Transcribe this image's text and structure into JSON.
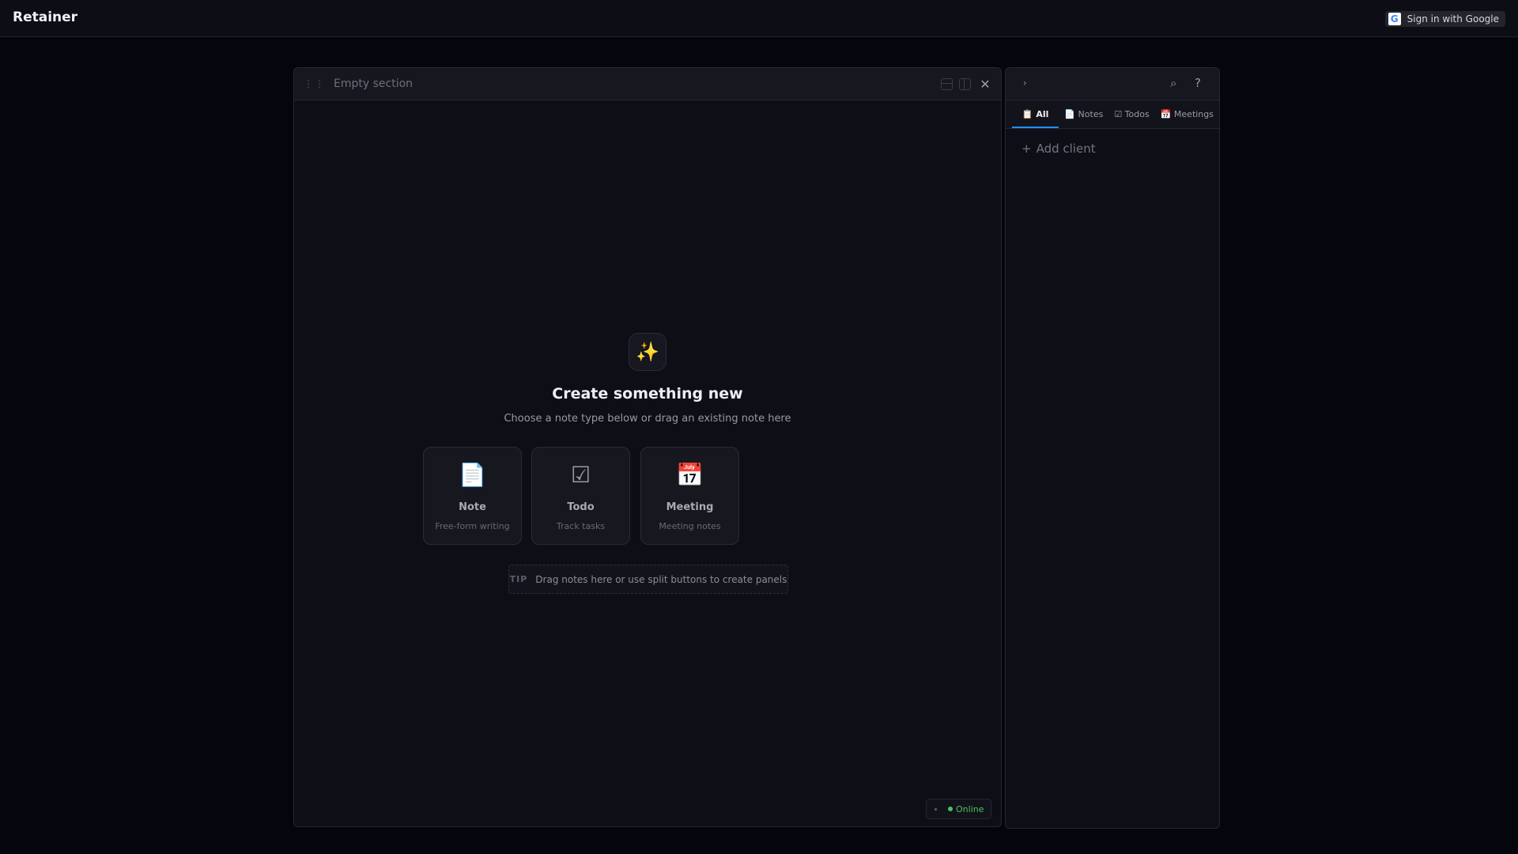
{
  "app": {
    "title": "Retainer",
    "signin_label": "Sign in with Google",
    "google_logo": "G"
  },
  "panel": {
    "title": "Empty section",
    "grip": "⋮⋮",
    "close": "✕",
    "sparkle_icon": "✨",
    "heading": "Create something new",
    "subheading": "Choose a note type below or drag an existing note here",
    "cards": [
      {
        "icon": "📄",
        "label": "Note",
        "desc": "Free-form writing"
      },
      {
        "icon": "☑",
        "label": "Todo",
        "desc": "Track tasks"
      },
      {
        "icon": "📅",
        "label": "Meeting",
        "desc": "Meeting notes"
      }
    ],
    "tip_label": "TIP",
    "tip_text": "Drag notes here or use split buttons to create panels",
    "status": "Online"
  },
  "sidebar": {
    "chevron": "›",
    "search": "⌕",
    "help": "?",
    "tabs": [
      {
        "label": "📋 All"
      },
      {
        "label": "📄 Notes"
      },
      {
        "label": "☑ Todos"
      },
      {
        "label": "📅 Meetings"
      }
    ],
    "add_client": "Add client",
    "add_icon": "+"
  },
  "colors": {
    "accent": "#1e8ef0",
    "online": "#4cc25a"
  }
}
